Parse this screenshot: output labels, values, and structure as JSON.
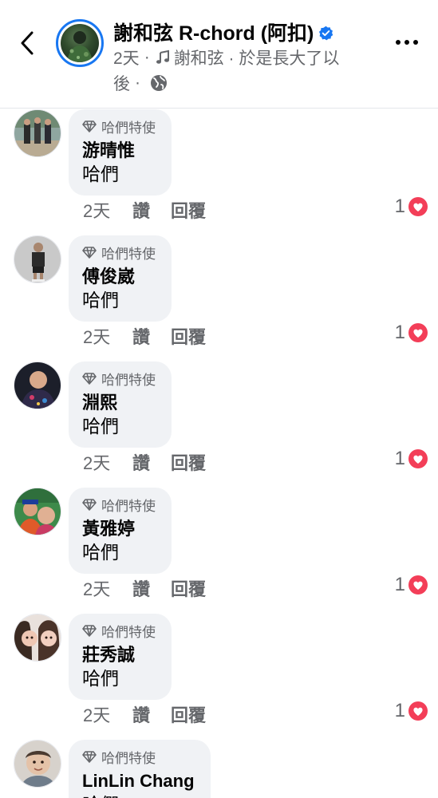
{
  "header": {
    "page_name": "謝和弦 R-chord (阿扣)",
    "time": "2天",
    "song": "謝和弦 · 於是長大了以",
    "song_cont": "後",
    "dot": "·"
  },
  "colors": {
    "brand": "#1877f2",
    "heart": "#f33e58",
    "secondary_text": "#65676b",
    "bubble": "#f0f2f5"
  },
  "comments": [
    {
      "badge": "哈們特使",
      "author": "游晴惟",
      "text": "哈們",
      "time": "2天",
      "like": "讚",
      "reply": "回覆",
      "reactions": "1"
    },
    {
      "badge": "哈們特使",
      "author": "傅俊崴",
      "text": "哈們",
      "time": "2天",
      "like": "讚",
      "reply": "回覆",
      "reactions": "1"
    },
    {
      "badge": "哈們特使",
      "author": "淵熙",
      "text": "哈們",
      "time": "2天",
      "like": "讚",
      "reply": "回覆",
      "reactions": "1"
    },
    {
      "badge": "哈們特使",
      "author": "黃雅婷",
      "text": "哈們",
      "time": "2天",
      "like": "讚",
      "reply": "回覆",
      "reactions": "1"
    },
    {
      "badge": "哈們特使",
      "author": "莊秀誠",
      "text": "哈們",
      "time": "2天",
      "like": "讚",
      "reply": "回覆",
      "reactions": "1"
    },
    {
      "badge": "哈們特使",
      "author": "LinLin Chang",
      "text": "哈們"
    }
  ]
}
